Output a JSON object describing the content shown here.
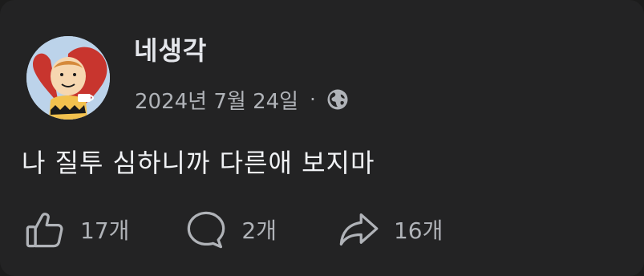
{
  "post": {
    "author": "네생각",
    "date": "2024년 7월 24일",
    "separator": "·",
    "privacy_icon": "globe-icon",
    "text": "나 질투 심하니까 다른애 보지마"
  },
  "actions": {
    "likes": "17개",
    "comments": "2개",
    "shares": "16개",
    "like_icon": "thumbs-up-icon",
    "comment_icon": "speech-bubble-icon",
    "share_icon": "share-arrow-icon"
  },
  "colors": {
    "background": "#232324",
    "text_primary": "#e4e6eb",
    "text_secondary": "#b0b3b8"
  }
}
